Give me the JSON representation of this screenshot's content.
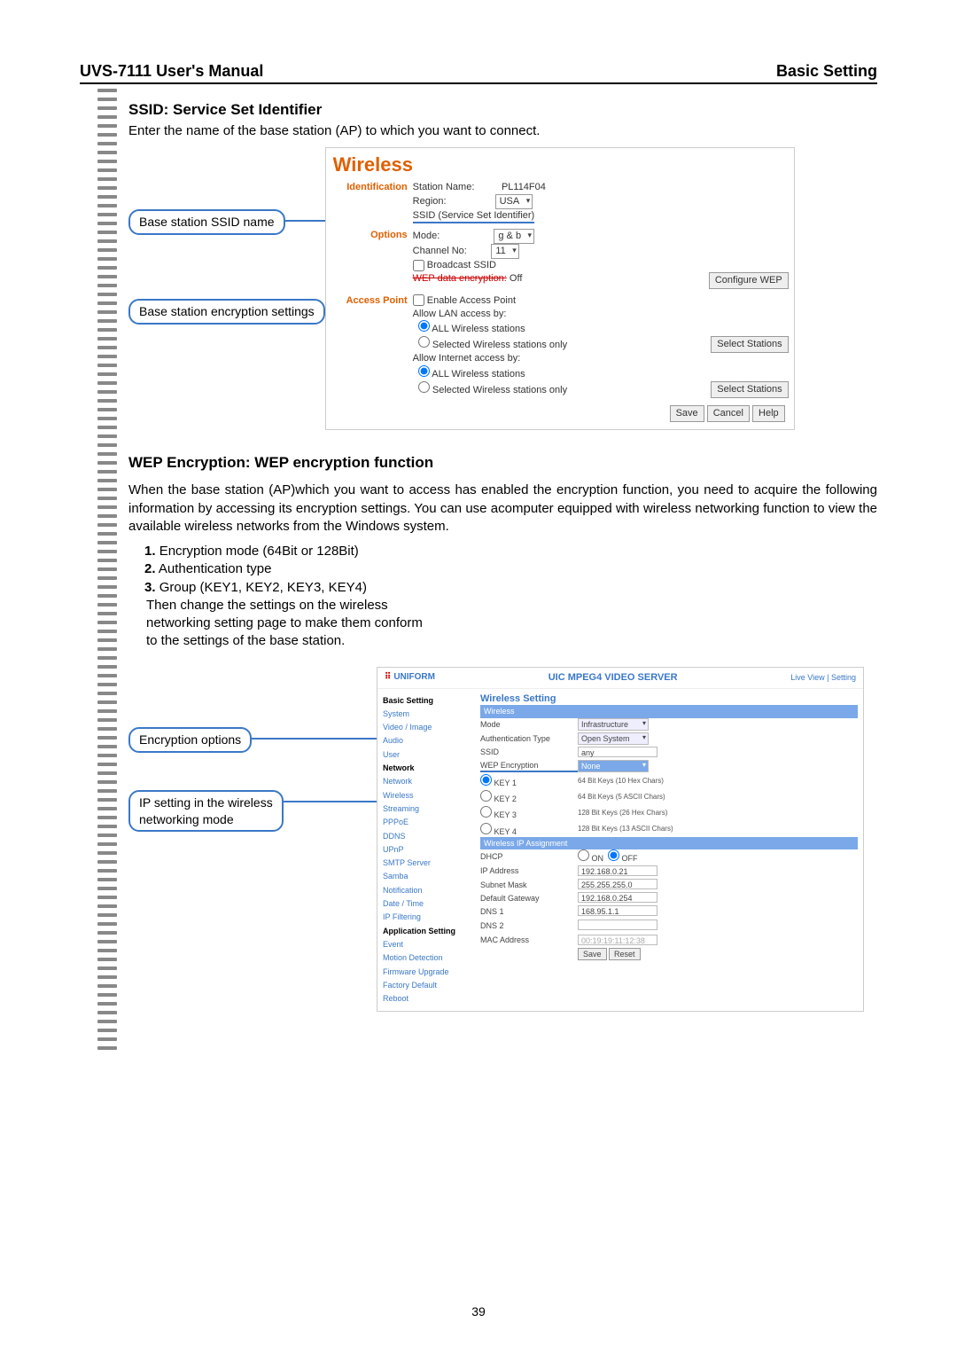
{
  "header": {
    "left": "UVS-7111 User's Manual",
    "right": "Basic Setting"
  },
  "ssid": {
    "title": "SSID: Service Set Identifier",
    "desc": "Enter the name of the base station (AP) to which you want to connect."
  },
  "callouts1": {
    "ssid_name": "Base station SSID name",
    "enc_settings": "Base station encryption settings"
  },
  "wireless_panel": {
    "title": "Wireless",
    "identification": {
      "label": "Identification",
      "station_name_lab": "Station Name:",
      "station_name_val": "PL114F04",
      "region_lab": "Region:",
      "region_val": "USA",
      "ssid_lab": "SSID (Service Set Identifier)"
    },
    "options": {
      "label": "Options",
      "mode_lab": "Mode:",
      "mode_val": "g & b",
      "channel_lab": "Channel No:",
      "channel_val": "11",
      "broadcast": "Broadcast SSID",
      "wep_lab": "WEP data encryption:",
      "wep_state": "Off",
      "configure": "Configure WEP"
    },
    "ap": {
      "label": "Access Point",
      "enable": "Enable Access Point",
      "lan_lab": "Allow LAN access by:",
      "all": "ALL Wireless stations",
      "sel": "Selected Wireless stations only",
      "inet_lab": "Allow Internet access by:",
      "select_btn": "Select Stations"
    },
    "buttons": {
      "save": "Save",
      "cancel": "Cancel",
      "help": "Help"
    }
  },
  "wep": {
    "title": "WEP Encryption: WEP encryption function",
    "para": "When the base station (AP)which you want to access has enabled the encryption function, you need to acquire the following information by accessing its encryption settings. You can use acomputer equipped with wireless networking function to view the available wireless networks from the Windows system.",
    "items": [
      "Encryption mode (64Bit or 128Bit)",
      "Authentication type",
      "Group (KEY1, KEY2, KEY3, KEY4)"
    ],
    "tail1": "Then change the settings on the wireless",
    "tail2": "networking setting page to make them conform",
    "tail3": "to the settings of the base station."
  },
  "callouts2": {
    "enc_opts": "Encryption options",
    "ip_setting1": "IP setting in the wireless",
    "ip_setting2": "networking mode"
  },
  "fig2": {
    "logo": "UNIFORM",
    "server": "UIC MPEG4 VIDEO SERVER",
    "links": {
      "live": "Live View",
      "setting": "Setting"
    },
    "sidebar": {
      "basic": "Basic Setting",
      "items1": [
        "System",
        "Video / Image",
        "Audio",
        "User"
      ],
      "net": "Network",
      "items2": [
        "Network",
        "Wireless",
        "Streaming",
        "PPPoE",
        "DDNS",
        "UPnP",
        "SMTP Server",
        "Samba",
        "Notification",
        "Date / Time",
        "IP Filtering"
      ],
      "app": "Application Setting",
      "items3": [
        "Event",
        "Motion Detection",
        "Firmware Upgrade",
        "Factory Default",
        "Reboot"
      ]
    },
    "main": {
      "title": "Wireless Setting",
      "sec_wireless": "Wireless",
      "mode_lab": "Mode",
      "mode_val": "Infrastructure",
      "auth_lab": "Authentication Type",
      "auth_val": "Open System",
      "ssid_lab": "SSID",
      "ssid_val": "any",
      "wep_lab": "WEP Encryption",
      "wep_val": "None",
      "keys": [
        "KEY 1",
        "KEY 2",
        "KEY 3",
        "KEY 4"
      ],
      "key_legend": [
        "64 Bit Keys (10 Hex Chars)",
        "64 Bit Keys (5 ASCII Chars)",
        "128 Bit Keys (26 Hex Chars)",
        "128 Bit Keys (13 ASCII Chars)"
      ],
      "sec_ip": "Wireless IP Assignment",
      "dhcp_lab": "DHCP",
      "dhcp_on": "ON",
      "dhcp_off": "OFF",
      "ip_lab": "IP Address",
      "ip_val": "192.168.0.21",
      "mask_lab": "Subnet Mask",
      "mask_val": "255.255.255.0",
      "gw_lab": "Default Gateway",
      "gw_val": "192.168.0.254",
      "dns1_lab": "DNS 1",
      "dns1_val": "168.95.1.1",
      "dns2_lab": "DNS 2",
      "mac_lab": "MAC Address",
      "mac_val": "00:19:19:11:12:38",
      "save": "Save",
      "reset": "Reset"
    }
  },
  "page": "39"
}
